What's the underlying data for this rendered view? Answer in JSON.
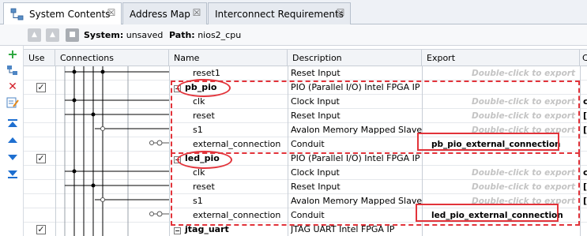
{
  "tabs": [
    {
      "label": "System Contents",
      "active": true
    },
    {
      "label": "Address Map",
      "active": false
    },
    {
      "label": "Interconnect Requirements",
      "active": false
    }
  ],
  "toolbar": {
    "system_label": "System:",
    "system_value": "unsaved",
    "path_label": "Path:",
    "path_value": "nios2_cpu"
  },
  "sidebar_icons": [
    "add-icon",
    "connect-icon",
    "remove-icon",
    "edit-icon",
    "move-top-icon",
    "move-up-icon",
    "move-down-icon",
    "move-bottom-icon"
  ],
  "table": {
    "columns": [
      "Use",
      "Connections",
      "Name",
      "Description",
      "Export",
      "C"
    ],
    "rows": [
      {
        "name": "reset1",
        "description": "Reset Input",
        "export": "Double-click to export",
        "export_set": false,
        "use": false,
        "header": false,
        "extra": ""
      },
      {
        "name": "pb_pio",
        "description": "PIO (Parallel I/O) Intel FPGA IP",
        "export": "",
        "export_set": false,
        "use": true,
        "header": true,
        "extra": ""
      },
      {
        "name": "clk",
        "description": "Clock Input",
        "export": "Double-click to export",
        "export_set": false,
        "use": false,
        "header": false,
        "extra": "c"
      },
      {
        "name": "reset",
        "description": "Reset Input",
        "export": "Double-click to export",
        "export_set": false,
        "use": false,
        "header": false,
        "extra": "["
      },
      {
        "name": "s1",
        "description": "Avalon Memory Mapped Slave",
        "export": "Double-click to export",
        "export_set": false,
        "use": false,
        "header": false,
        "extra": "["
      },
      {
        "name": "external_connection",
        "description": "Conduit",
        "export": "pb_pio_external_connection",
        "export_set": true,
        "use": false,
        "header": false,
        "extra": ""
      },
      {
        "name": "led_pio",
        "description": "PIO (Parallel I/O) Intel FPGA IP",
        "export": "",
        "export_set": false,
        "use": true,
        "header": true,
        "extra": ""
      },
      {
        "name": "clk",
        "description": "Clock Input",
        "export": "Double-click to export",
        "export_set": false,
        "use": false,
        "header": false,
        "extra": "c"
      },
      {
        "name": "reset",
        "description": "Reset Input",
        "export": "Double-click to export",
        "export_set": false,
        "use": false,
        "header": false,
        "extra": "["
      },
      {
        "name": "s1",
        "description": "Avalon Memory Mapped Slave",
        "export": "Double-click to export",
        "export_set": false,
        "use": false,
        "header": false,
        "extra": "["
      },
      {
        "name": "external_connection",
        "description": "Conduit",
        "export": "led_pio_external_connection",
        "export_set": true,
        "use": false,
        "header": false,
        "extra": ""
      },
      {
        "name": "jtag_uart",
        "description": "JTAG UART Intel FPGA IP",
        "export": "",
        "export_set": false,
        "use": true,
        "header": true,
        "extra": ""
      }
    ]
  },
  "colors": {
    "highlight": "#e2333a",
    "export_hint": "#c4c4c4",
    "selected_row": "#f0f3f7"
  }
}
